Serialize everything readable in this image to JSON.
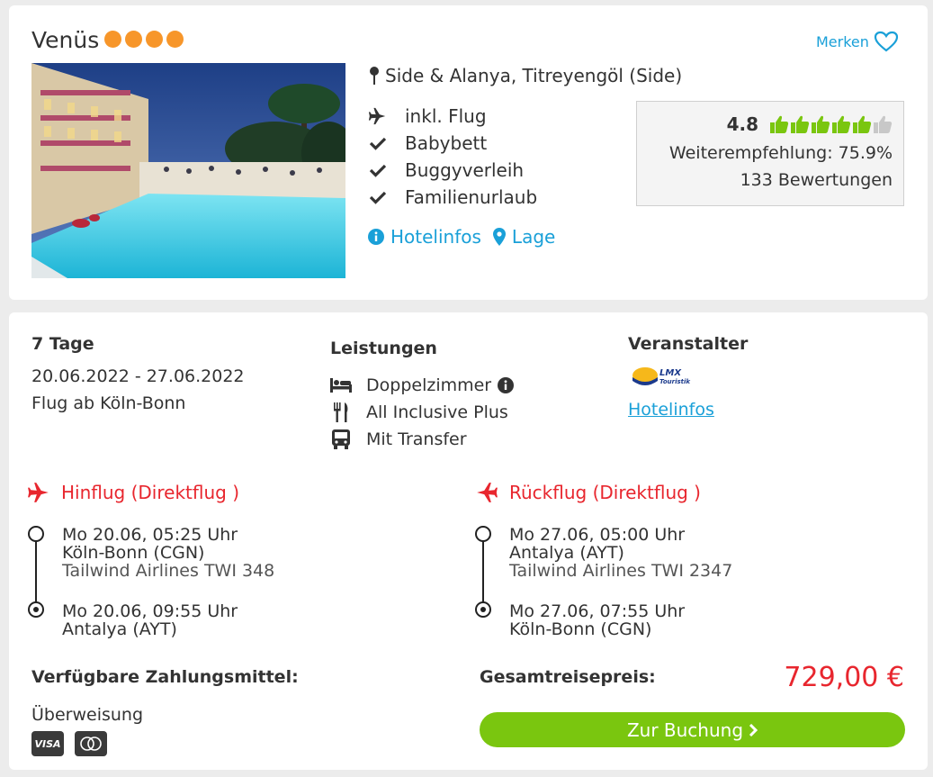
{
  "hotel": {
    "name": "Venüs",
    "stars": 4,
    "merken_label": "Merken",
    "location": "Side & Alanya, Titreyengöl (Side)",
    "features": [
      "inkl. Flug",
      "Babybett",
      "Buggyverleih",
      "Familienurlaub"
    ],
    "links": {
      "hotelinfos": "Hotelinfos",
      "lage": "Lage"
    },
    "rating": {
      "score": "4.8",
      "thumbs_filled": 5,
      "thumbs_total": 6,
      "recommendation": "Weiterempfehlung: 75.9%",
      "reviews": "133 Bewertungen"
    }
  },
  "offer": {
    "duration": "7 Tage",
    "dates": "20.06.2022 - 27.06.2022",
    "departure": "Flug ab Köln-Bonn",
    "leistungen_heading": "Leistungen",
    "services": [
      "Doppelzimmer",
      "All Inclusive Plus",
      "Mit Transfer"
    ],
    "veranstalter_heading": "Veranstalter",
    "veranstalter_logo_text": "LMX Touristik",
    "veranstalter_link": "Hotelinfos"
  },
  "outbound": {
    "title": "Hinflug (Direktflug )",
    "depart_time": "Mo 20.06, 05:25 Uhr",
    "depart_airport": "Köln-Bonn (CGN)",
    "airline": "Tailwind Airlines TWI 348",
    "arrive_time": "Mo 20.06, 09:55 Uhr",
    "arrive_airport": "Antalya (AYT)"
  },
  "return": {
    "title": "Rückflug (Direktflug )",
    "depart_time": "Mo 27.06, 05:00 Uhr",
    "depart_airport": "Antalya (AYT)",
    "airline": "Tailwind Airlines TWI 2347",
    "arrive_time": "Mo 27.06, 07:55 Uhr",
    "arrive_airport": "Köln-Bonn (CGN)"
  },
  "payment": {
    "heading": "Verfügbare Zahlungsmittel:",
    "method": "Überweisung",
    "card_visa": "VISA"
  },
  "total": {
    "heading": "Gesamtreisepreis:",
    "price": "729,00 €",
    "book_label": "Zur Buchung"
  },
  "colors": {
    "accent_blue": "#1aa0d8",
    "accent_red": "#e8262e",
    "accent_green": "#7ac60f",
    "star_orange": "#f7962a"
  }
}
